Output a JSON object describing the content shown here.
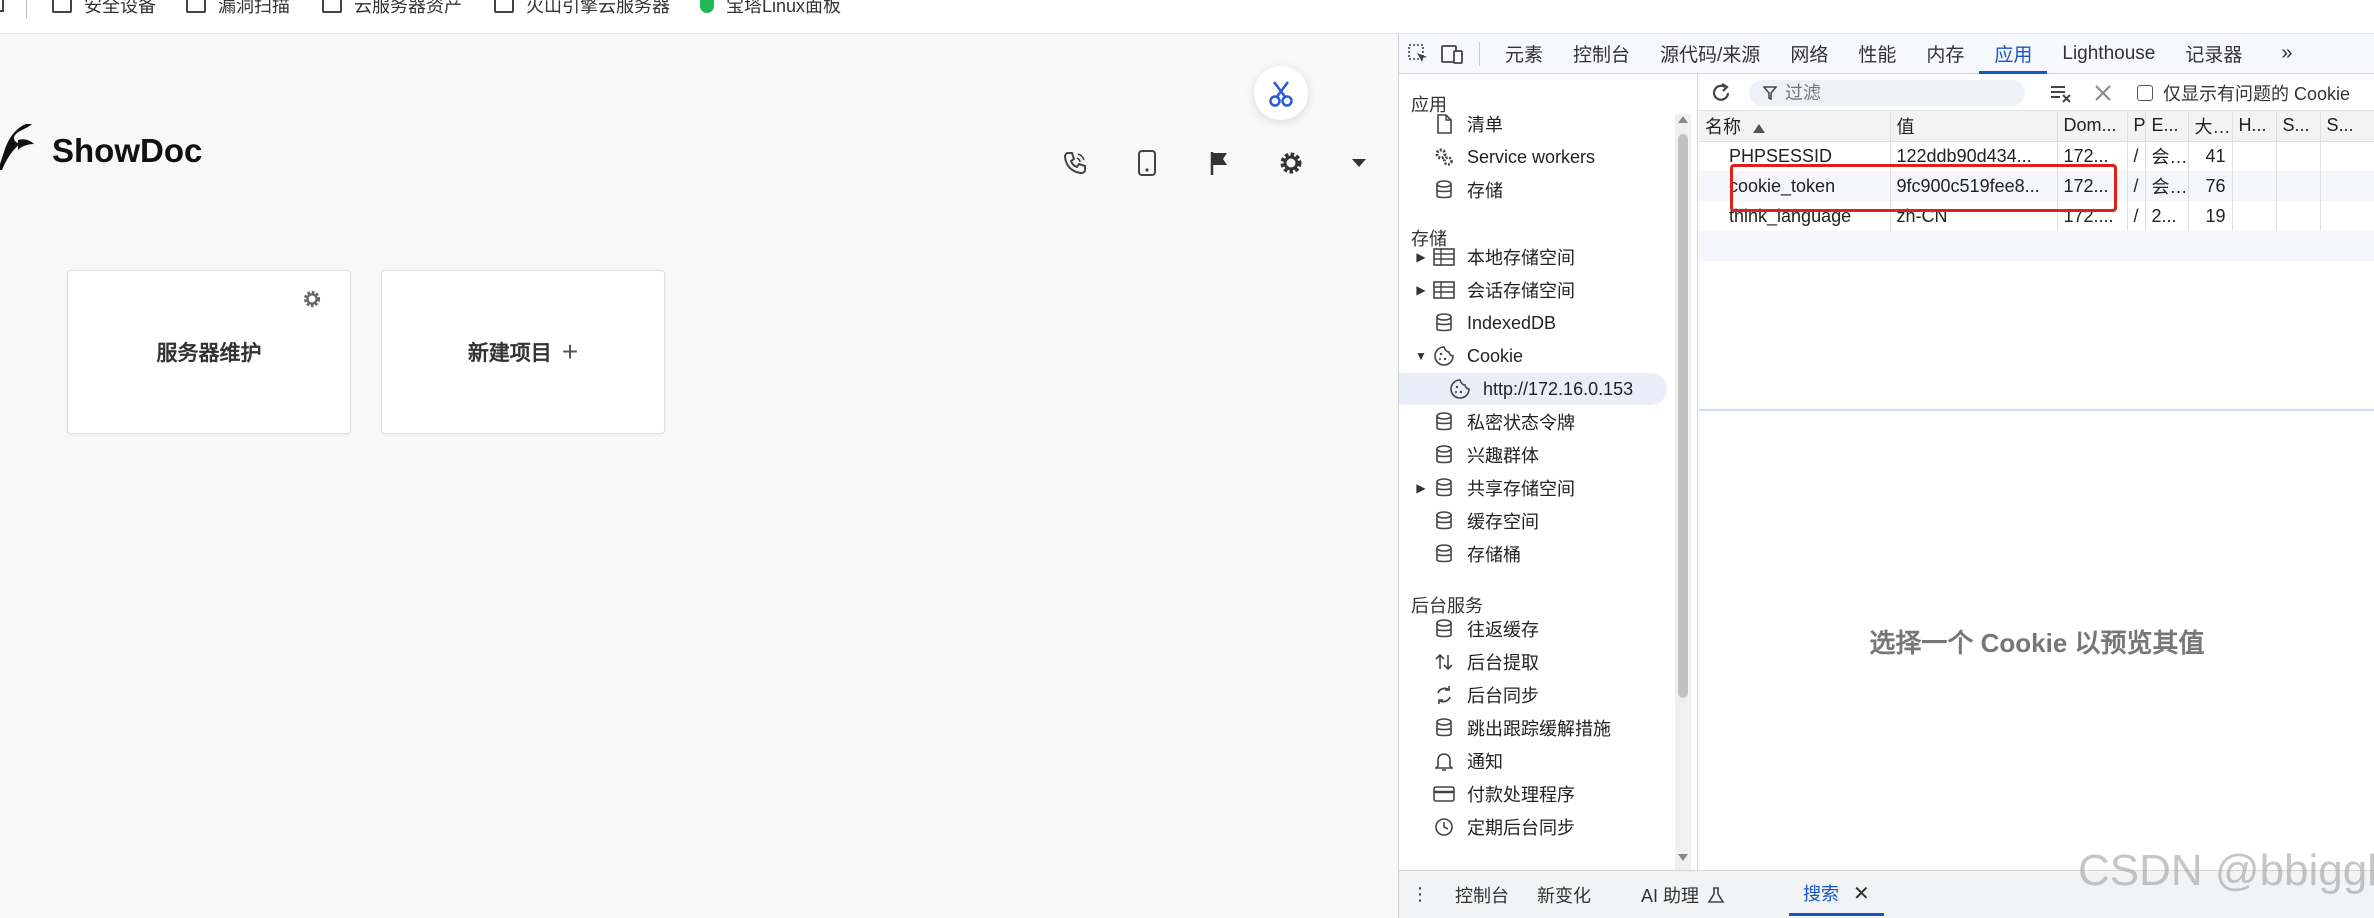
{
  "bookmarks": [
    {
      "label": "安全设备",
      "icon": "folder-icon"
    },
    {
      "label": "漏洞扫描",
      "icon": "folder-icon"
    },
    {
      "label": "云服务器资产",
      "icon": "folder-icon"
    },
    {
      "label": "火山引擎云服务器",
      "icon": "folder-icon"
    },
    {
      "label": "宝塔Linux面板",
      "icon": "shield-icon"
    }
  ],
  "app": {
    "brand": "ShowDoc",
    "cards": [
      {
        "title": "服务器维护"
      },
      {
        "title": "新建项目",
        "suffix": "+"
      }
    ]
  },
  "devtools": {
    "tabs": [
      "元素",
      "控制台",
      "源代码/来源",
      "网络",
      "性能",
      "内存",
      "应用",
      "Lighthouse",
      "记录器"
    ],
    "active_tab": "应用",
    "more": "»",
    "sidebar": {
      "section_app": "应用",
      "app_items": [
        "清单",
        "Service workers",
        "存储"
      ],
      "section_storage": "存储",
      "storage_items": [
        "本地存储空间",
        "会话存储空间",
        "IndexedDB",
        "Cookie",
        "http://172.16.0.153",
        "私密状态令牌",
        "兴趣群体",
        "共享存储空间",
        "缓存空间",
        "存储桶"
      ],
      "section_background": "后台服务",
      "background_items": [
        "往返缓存",
        "后台提取",
        "后台同步",
        "跳出跟踪缓解措施",
        "通知",
        "付款处理程序",
        "定期后台同步"
      ]
    },
    "filter_placeholder": "过滤",
    "only_issues_label": "仅显示有问题的 Cookie",
    "columns": [
      "名称",
      "值",
      "Dom...",
      "P",
      "E...",
      "大...",
      "H...",
      "S...",
      "S..."
    ],
    "rows": [
      {
        "name": "PHPSESSID",
        "value": "122ddb90d434...",
        "domain": "172...",
        "path": "/",
        "expires": "会...",
        "size": "41"
      },
      {
        "name": "cookie_token",
        "value": "9fc900c519fee8...",
        "domain": "172...",
        "path": "/",
        "expires": "会...",
        "size": "76"
      },
      {
        "name": "think_language",
        "value": "zh-CN",
        "domain": "172....",
        "path": "/",
        "expires": "2...",
        "size": "19"
      }
    ],
    "preview_text": "选择一个 Cookie 以预览其值",
    "drawer": [
      "控制台",
      "新变化",
      "AI 助理",
      "搜索"
    ],
    "drawer_active": "搜索"
  },
  "watermark": "CSDN @bbiggl",
  "colors": {
    "accent": "#1a55c7",
    "highlight": "#e0201a"
  }
}
